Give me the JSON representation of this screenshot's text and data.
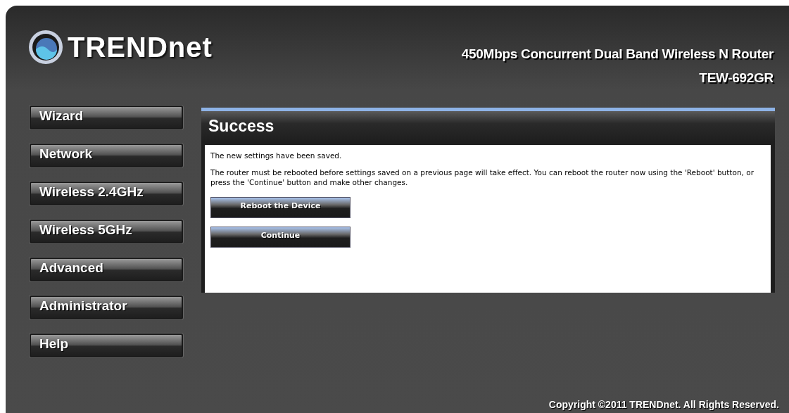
{
  "header": {
    "logo": "TRENDnet",
    "product": "450Mbps Concurrent Dual Band Wireless N Router",
    "model": "TEW-692GR"
  },
  "sidebar": {
    "items": [
      {
        "label": "Wizard"
      },
      {
        "label": "Network"
      },
      {
        "label": "Wireless 2.4GHz"
      },
      {
        "label": "Wireless 5GHz"
      },
      {
        "label": "Advanced"
      },
      {
        "label": "Administrator"
      },
      {
        "label": "Help"
      }
    ]
  },
  "panel": {
    "title": "Success",
    "paragraphs": [
      "The new settings have been saved.",
      "The router must be rebooted before settings saved on a previous page will take effect. You can reboot the router now using the 'Reboot' button, or press the 'Continue' button and make other changes."
    ],
    "buttons": [
      "Reboot the Device",
      "Continue"
    ]
  },
  "footer": {
    "copyright": "Copyright ©2011 TRENDnet. All Rights Reserved."
  }
}
